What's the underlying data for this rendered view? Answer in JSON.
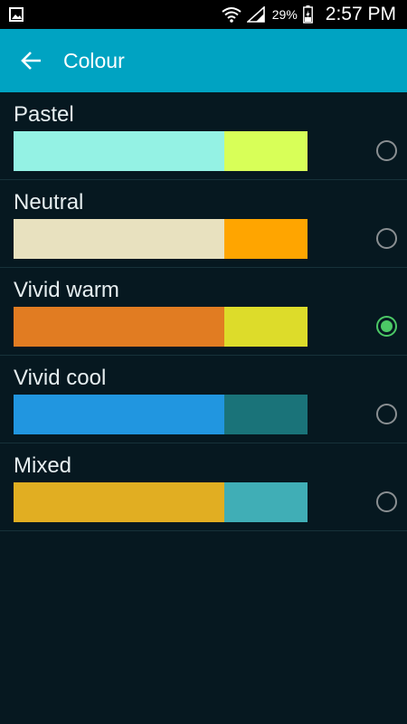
{
  "status_bar": {
    "battery_percent": "29%",
    "time": "2:57 PM",
    "icons": [
      "gallery-icon",
      "wifi-icon",
      "signal-icon",
      "battery-icon"
    ]
  },
  "app_bar": {
    "title": "Colour",
    "back_icon": "arrow-left-icon",
    "color": "#00A3C2"
  },
  "options": [
    {
      "label": "Pastel",
      "main_color": "#94F2E4",
      "accent_color": "#D8FF58",
      "selected": false
    },
    {
      "label": "Neutral",
      "main_color": "#E8E1BF",
      "accent_color": "#FFA500",
      "selected": false
    },
    {
      "label": "Vivid warm",
      "main_color": "#E17C22",
      "accent_color": "#DDDC2A",
      "selected": true
    },
    {
      "label": "Vivid cool",
      "main_color": "#2196E0",
      "accent_color": "#1A7379",
      "selected": false
    },
    {
      "label": "Mixed",
      "main_color": "#E1AE22",
      "accent_color": "#40AEB6",
      "selected": false
    }
  ]
}
